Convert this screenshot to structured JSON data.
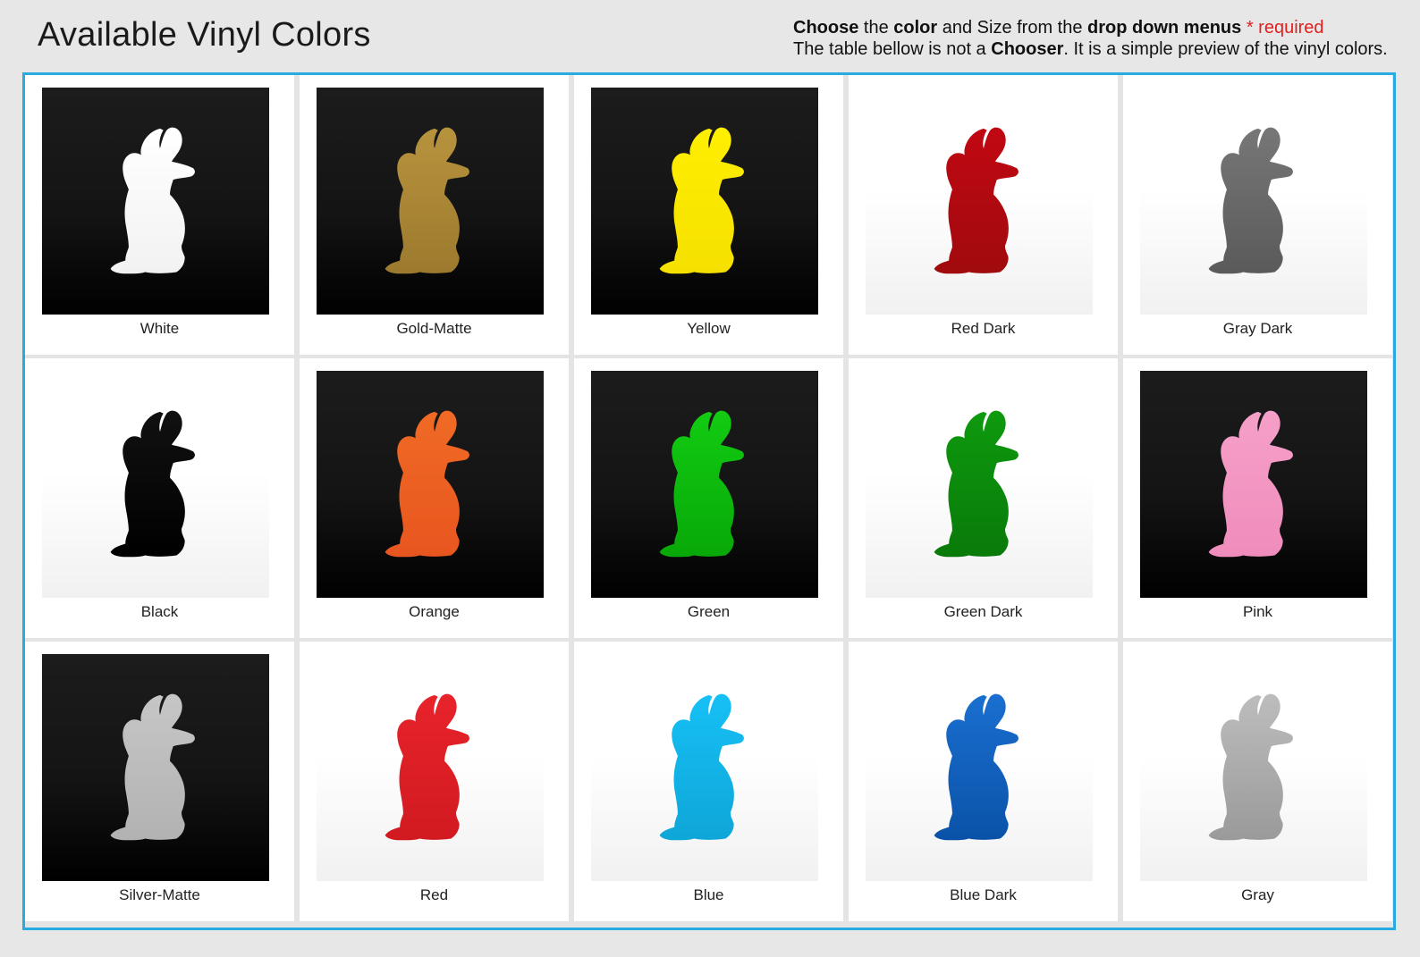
{
  "header": {
    "title": "Available Vinyl Colors",
    "line1": {
      "choose": "Choose",
      "the": " the ",
      "color": "color",
      "and_size": " and Size from the ",
      "drop_down": "drop down menus",
      "required": " * required"
    },
    "line2": {
      "prefix": "The table bellow is not a ",
      "chooser": "Chooser",
      "suffix": ". It is a simple preview of the vinyl colors."
    }
  },
  "colors": {
    "accent_border": "#29abe2",
    "required_text": "#e02020"
  },
  "swatches": [
    {
      "label": "White",
      "bg": "dark",
      "fill": "#ffffff",
      "fill_bottom": "#f2f2f2"
    },
    {
      "label": "Gold-Matte",
      "bg": "dark",
      "fill": "#b8933e",
      "fill_bottom": "#9c7a2e"
    },
    {
      "label": "Yellow",
      "bg": "dark",
      "fill": "#ffef00",
      "fill_bottom": "#f5e000"
    },
    {
      "label": "Red Dark",
      "bg": "light",
      "fill": "#c10812",
      "fill_bottom": "#a00a0e"
    },
    {
      "label": "Gray Dark",
      "bg": "light",
      "fill": "#777777",
      "fill_bottom": "#5a5a5a"
    },
    {
      "label": "Black",
      "bg": "light",
      "fill": "#111111",
      "fill_bottom": "#000000"
    },
    {
      "label": "Orange",
      "bg": "dark",
      "fill": "#f06a25",
      "fill_bottom": "#e8561f"
    },
    {
      "label": "Green",
      "bg": "dark",
      "fill": "#12cc12",
      "fill_bottom": "#08a808"
    },
    {
      "label": "Green Dark",
      "bg": "light",
      "fill": "#0e9a0e",
      "fill_bottom": "#097a09"
    },
    {
      "label": "Pink",
      "bg": "dark",
      "fill": "#f5a0c8",
      "fill_bottom": "#f08cbc"
    },
    {
      "label": "Silver-Matte",
      "bg": "dark",
      "fill": "#c6c6c6",
      "fill_bottom": "#b2b2b2"
    },
    {
      "label": "Red",
      "bg": "light",
      "fill": "#e8232b",
      "fill_bottom": "#d11a20"
    },
    {
      "label": "Blue",
      "bg": "light",
      "fill": "#16c0f5",
      "fill_bottom": "#0fa6d8"
    },
    {
      "label": "Blue Dark",
      "bg": "light",
      "fill": "#1a6fd0",
      "fill_bottom": "#0a52a8"
    },
    {
      "label": "Gray",
      "bg": "light",
      "fill": "#bdbdbd",
      "fill_bottom": "#9a9a9a"
    }
  ]
}
